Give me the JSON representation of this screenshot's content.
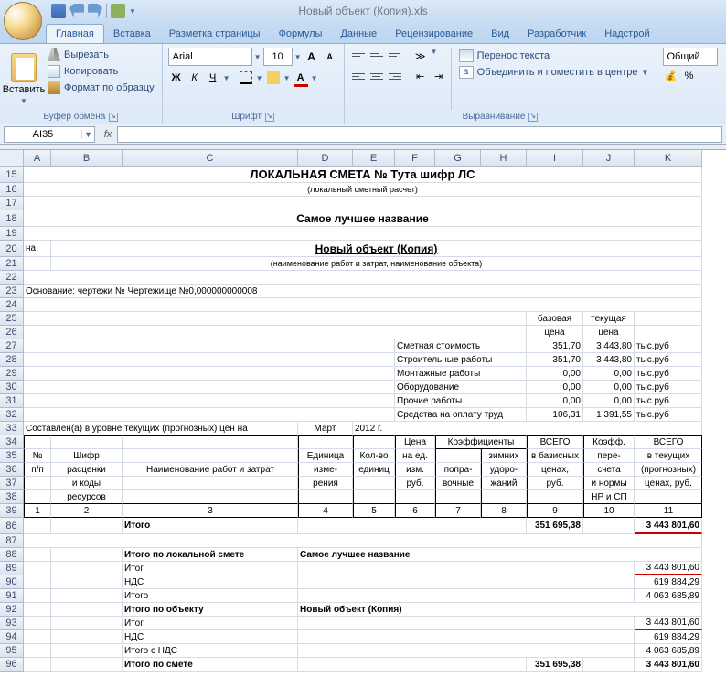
{
  "window": {
    "title": "Новый объект (Копия).xls"
  },
  "tabs": {
    "home": "Главная",
    "insert": "Вставка",
    "layout": "Разметка страницы",
    "formulas": "Формулы",
    "data": "Данные",
    "review": "Рецензирование",
    "view": "Вид",
    "developer": "Разработчик",
    "addins": "Надстрой"
  },
  "ribbon": {
    "paste": "Вставить",
    "cut": "Вырезать",
    "copy": "Копировать",
    "format_painter": "Формат по образцу",
    "clipboard": "Буфер обмена",
    "font_name": "Arial",
    "font_size": "10",
    "grow": "А",
    "shrink": "А",
    "bold": "Ж",
    "italic": "К",
    "underline": "Ч",
    "font": "Шрифт",
    "wrap": "Перенос текста",
    "merge": "Объединить и поместить в центре",
    "alignment": "Выравнивание",
    "number_format": "Общий"
  },
  "namebox": "AI35",
  "sheet": {
    "title1": "ЛОКАЛЬНАЯ СМЕТА №  Тута шифр ЛС",
    "title1sub": "(локальный сметный расчет)",
    "title2": "Самое лучшее название",
    "title3pre": "на",
    "title3": "Новый объект (Копия)",
    "title3sub": "(наименование работ и затрат, наименование объекта)",
    "basis": "Основание: чертежи № Чертежище №0,000000000008",
    "col_base": "базовая",
    "col_curr": "текущая",
    "col_price": "цена",
    "row_smeta": "Сметная стоимость",
    "row_build": "Строительные работы",
    "row_mont": "Монтажные работы",
    "row_equip": "Оборудование",
    "row_other": "Прочие работы",
    "row_labor": "Средства на оплату труд",
    "v_smeta_b": "351,70",
    "v_smeta_c": "3 443,80",
    "v_build_b": "351,70",
    "v_build_c": "3 443,80",
    "v_mont_b": "0,00",
    "v_mont_c": "0,00",
    "v_equip_b": "0,00",
    "v_equip_c": "0,00",
    "v_other_b": "0,00",
    "v_other_c": "0,00",
    "v_labor_b": "106,31",
    "v_labor_c": "1 391,55",
    "unit": "тыс.руб",
    "compiled": "Составлен(а) в уровне текущих (прогнозных) цен на",
    "month": "Март",
    "year": "2012 г.",
    "hdr": {
      "num": "№",
      "pp": "п/п",
      "code1": "Шифр",
      "code2": "расценки",
      "code3": "и коды",
      "code4": "ресурсов",
      "name": "Наименование работ и затрат",
      "unit1": "Единица",
      "unit2": "изме-",
      "unit3": "рения",
      "qty1": "Кол-во",
      "qty2": "единиц",
      "price1": "Цена",
      "price2": "на ед.",
      "price3": "изм.",
      "price4": "руб.",
      "coef": "Коэффициенты",
      "corr1": "попра-",
      "corr2": "вочные",
      "wint1": "зимних",
      "wint2": "удоро-",
      "wint3": "жаний",
      "tot_b1": "ВСЕГО",
      "tot_b2": "в базисных",
      "tot_b3": "ценах,",
      "tot_b4": "руб.",
      "kf1": "Коэфф.",
      "kf2": "пере-",
      "kf3": "счета",
      "kf4": "и нормы",
      "kf5": "НР и СП",
      "tot_c1": "ВСЕГО",
      "tot_c2": "в текущих",
      "tot_c3": "(прогнозных)",
      "tot_c4": "ценах, руб."
    },
    "hnum": {
      "c1": "1",
      "c2": "2",
      "c3": "3",
      "c4": "4",
      "c5": "5",
      "c6": "6",
      "c7": "7",
      "c8": "8",
      "c9": "9",
      "c10": "10",
      "c11": "11"
    },
    "itogo": "Итого",
    "itogo_local": "Итого по локальной смете",
    "itogo_obj": "Итого по объекту",
    "itog": "Итог",
    "nds": "НДС",
    "itogo_nds": "Итого с НДС",
    "itogo_smeta": "Итого по смете",
    "name2": "Самое лучшее название",
    "name3": "Новый объект (Копия)",
    "v_itogo_b": "351 695,38",
    "v_itogo_c": "3 443 801,60",
    "v_nds": "619 884,29",
    "v_itogo_all": "4 063 685,89"
  },
  "rows": [
    "15",
    "16",
    "17",
    "18",
    "19",
    "20",
    "21",
    "22",
    "23",
    "24",
    "25",
    "26",
    "27",
    "28",
    "29",
    "30",
    "31",
    "32",
    "33",
    "34",
    "35",
    "36",
    "37",
    "38",
    "39",
    "86",
    "87",
    "88",
    "89",
    "90",
    "91",
    "92",
    "93",
    "94",
    "95",
    "96"
  ],
  "cols": [
    "A",
    "B",
    "C",
    "D",
    "E",
    "F",
    "G",
    "H",
    "I",
    "J",
    "K"
  ]
}
